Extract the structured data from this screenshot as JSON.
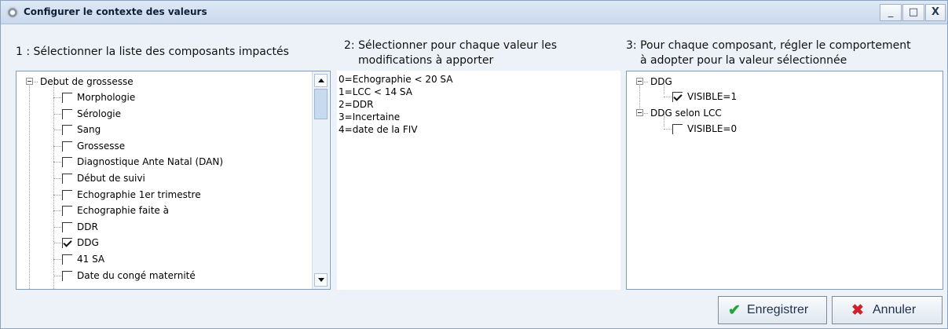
{
  "window": {
    "title": "Configurer le contexte des valeurs",
    "buttons": {
      "minimize": "_",
      "maximize": "□",
      "close": "X"
    }
  },
  "sections": {
    "left_title": "1 : Sélectionner la liste des composants impactés",
    "middle_title_line1": "2: Sélectionner pour chaque valeur les",
    "middle_title_line2": "modifications à apporter",
    "right_title_line1": "3: Pour chaque composant, régler le comportement",
    "right_title_line2": "à adopter pour la valeur sélectionnée"
  },
  "left_tree": {
    "root": "Debut de grossesse",
    "items": [
      {
        "label": "Morphologie",
        "checked": false
      },
      {
        "label": "Sérologie",
        "checked": false
      },
      {
        "label": "Sang",
        "checked": false
      },
      {
        "label": "Grossesse",
        "checked": false
      },
      {
        "label": "Diagnostique Ante Natal (DAN)",
        "checked": false
      },
      {
        "label": "Début de suivi",
        "checked": false
      },
      {
        "label": "Echographie 1er trimestre",
        "checked": false
      },
      {
        "label": "Echographie faite à",
        "checked": false
      },
      {
        "label": "DDR",
        "checked": false
      },
      {
        "label": "DDG",
        "checked": true
      },
      {
        "label": "41 SA",
        "checked": false
      },
      {
        "label": "Date du congé maternité",
        "checked": false
      }
    ]
  },
  "values_list": [
    "0=Echographie < 20 SA",
    "1=LCC < 14 SA",
    "2=DDR",
    "3=Incertaine",
    "4=date de la FIV"
  ],
  "right_tree": [
    {
      "parent": "DDG",
      "child": "VISIBLE=1",
      "checked": true
    },
    {
      "parent": "DDG selon LCC",
      "child": "VISIBLE=0",
      "checked": false
    }
  ],
  "actions": {
    "save": "Enregistrer",
    "cancel": "Annuler",
    "save_icon": "✔",
    "cancel_icon": "✖",
    "save_icon_color": "#21a63a",
    "cancel_icon_color": "#d21f2b"
  }
}
